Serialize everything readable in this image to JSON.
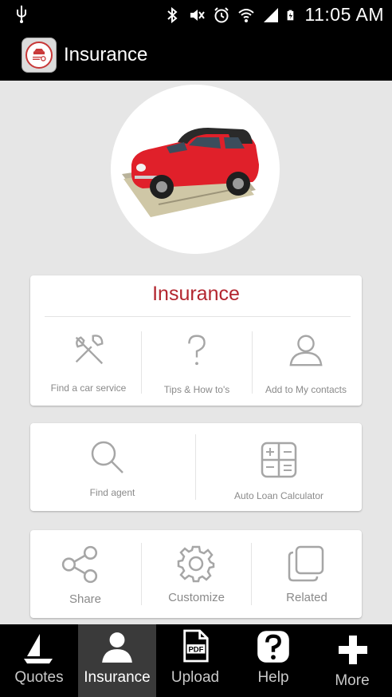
{
  "status_bar": {
    "time": "11:05 AM"
  },
  "header": {
    "title": "Insurance"
  },
  "card_main": {
    "title": "Insurance",
    "items": [
      {
        "label": "Find a car service",
        "icon": "tools-icon"
      },
      {
        "label": "Tips & How to's",
        "icon": "question-mark-icon"
      },
      {
        "label": "Add to My contacts",
        "icon": "person-icon"
      }
    ]
  },
  "card_tools": {
    "items": [
      {
        "label": "Find agent",
        "icon": "magnifier-icon"
      },
      {
        "label": "Auto Loan Calculator",
        "icon": "calculator-icon"
      }
    ]
  },
  "card_more": {
    "items": [
      {
        "label": "Share",
        "icon": "share-icon"
      },
      {
        "label": "Customize",
        "icon": "gear-icon"
      },
      {
        "label": "Related",
        "icon": "stacked-squares-icon"
      }
    ]
  },
  "tabs": [
    {
      "label": "Quotes",
      "icon": "sailboat-icon"
    },
    {
      "label": "Insurance",
      "icon": "person-icon",
      "active": true
    },
    {
      "label": "Upload",
      "icon": "pdf-file-icon",
      "badge": "PDF"
    },
    {
      "label": "Help",
      "icon": "help-icon"
    },
    {
      "label": "More",
      "icon": "plus-icon"
    }
  ],
  "colors": {
    "accent": "#b3262f",
    "tab_active_bg": "#3a3a3a",
    "car": "#e0202a"
  }
}
